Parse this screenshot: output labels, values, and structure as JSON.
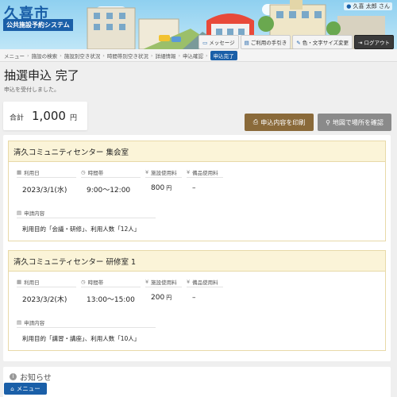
{
  "header": {
    "city": "久喜市",
    "system": "公共施設予約システム",
    "user": "久喜 太郎 さん",
    "buttons": [
      {
        "label": "メッセージ",
        "icon": "comment-icon"
      },
      {
        "label": "ご利用の手引き",
        "icon": "book-icon"
      },
      {
        "label": "色・文字サイズ変更",
        "icon": "brush-icon"
      },
      {
        "label": "ログアウト",
        "icon": "logout-icon"
      }
    ]
  },
  "breadcrumb": [
    "メニュー",
    "施設の検索",
    "施設別空き状況",
    "時間帯別空き状況",
    "詳細情報",
    "申込確認",
    "申込完了"
  ],
  "page": {
    "title": "抽選申込 完了",
    "message": "申込を受付しました。"
  },
  "total": {
    "label": "合計",
    "amount": "1,000",
    "unit": "円"
  },
  "actions": {
    "print": "申込内容を印刷",
    "map": "地図で場所を確認"
  },
  "labels": {
    "date": "利用日",
    "time": "時間帯",
    "fee": "施設使用料",
    "equip": "備品使用料",
    "details": "申請内容",
    "yen": "円"
  },
  "bookings": [
    {
      "facility": "清久コミュニティセンター 集会室",
      "date": "2023/3/1(水)",
      "time": "9:00～12:00",
      "fee": "800",
      "equip": "–",
      "details": "利用目的「会議・研修」、利用人数「12人」"
    },
    {
      "facility": "清久コミュニティセンター 研修室 1",
      "date": "2023/3/2(木)",
      "time": "13:00～15:00",
      "fee": "200",
      "equip": "–",
      "details": "利用目的「講習・講座」、利用人数「10人」"
    }
  ],
  "notice": {
    "title": "お知らせ"
  },
  "menu": {
    "label": "メニュー"
  },
  "colors": {
    "brand": "#1a5fa8",
    "print": "#8a6a3a",
    "map": "#8a8a8a",
    "card_head": "#fbf4d8"
  }
}
